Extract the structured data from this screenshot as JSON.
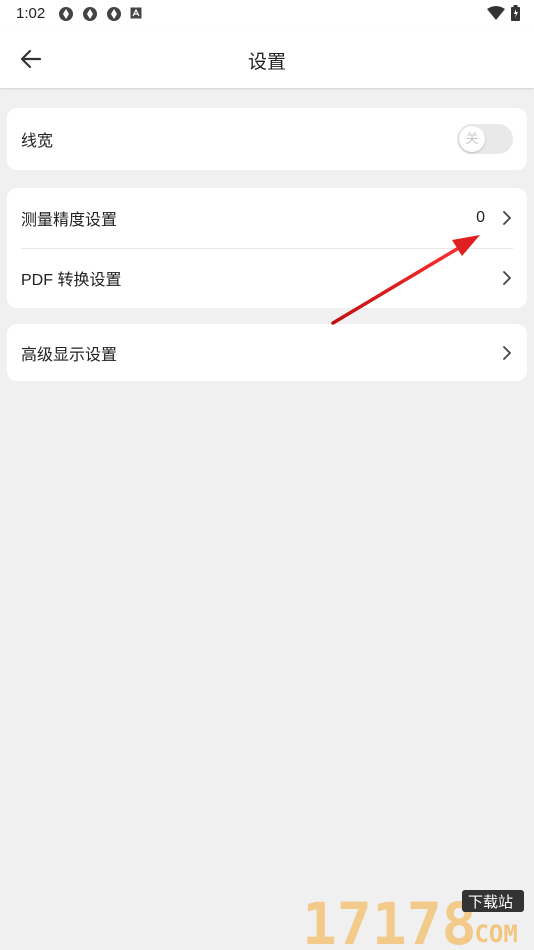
{
  "status_bar": {
    "time": "1:02",
    "icons_left": [
      "app-notification-icon",
      "app-notification-icon",
      "app-notification-icon",
      "a-box-icon"
    ],
    "icons_right": [
      "wifi-icon",
      "battery-icon"
    ]
  },
  "app_bar": {
    "title": "设置",
    "back_icon": "arrow-left-icon"
  },
  "settings": {
    "line_width": {
      "label": "线宽",
      "toggle_text": "关",
      "enabled": false
    },
    "measure_precision": {
      "label": "测量精度设置",
      "value": "0"
    },
    "pdf_convert": {
      "label": "PDF 转换设置"
    },
    "advanced_display": {
      "label": "高级显示设置"
    }
  },
  "annotation": {
    "arrow_color": "#e02020"
  },
  "watermark": {
    "big_text": "17178",
    "tag_text": "下载站",
    "domain_text": ".COM"
  },
  "colors": {
    "background": "#f0f0f0",
    "card": "#ffffff",
    "toggle_off": "#e9e9e9",
    "divider": "#e6e6e6"
  }
}
